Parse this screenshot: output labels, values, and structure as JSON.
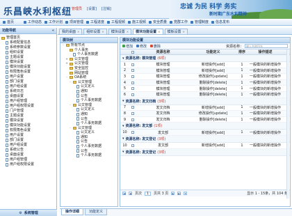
{
  "header": {
    "logo": "乐昌峡水利枢纽",
    "links": [
      "管理员",
      "[设置]",
      "[注销]"
    ],
    "slogan_main": "忠诚  为民  科学  务实",
    "slogan_sub": "新时期广东水利精神"
  },
  "menu": [
    "首页",
    "工作动态",
    "工作计划",
    "项目管理",
    "工程进度",
    "工程视频",
    "施工视频",
    "安全质量",
    "党群工作",
    "管理制度",
    "信息发布"
  ],
  "sidebar": {
    "title": "功能导航",
    "items": [
      "管理首页",
      "系统配置信息",
      "系统参数设置",
      "组织设置",
      "主题设置",
      "模块设置",
      "模块功能设置",
      "权限角色设置",
      "用户设置",
      "部门设置",
      "用户组设置",
      "系统日志",
      "桌面设置",
      "用户组管理",
      "用户组权限设置",
      "门户管理",
      "主题设置",
      "模块设置",
      "模块功能设置",
      "权限角色设置",
      "用户设置",
      "部门设置",
      "用户组设置",
      "系统公告",
      "桌面设置",
      "用户组管理",
      "用户组权限设置"
    ],
    "bottom_label": "系统管理"
  },
  "tabs": [
    "我的桌面",
    "组织设置",
    "模块设置",
    "模块功能设置",
    "模板设置"
  ],
  "tree": {
    "title": "模块树",
    "root": "所有节点",
    "nodes": [
      {
        "label": "个人事务",
        "depth": 1,
        "type": "folder",
        "toggle": ""
      },
      {
        "label": "个人事务数据",
        "depth": 2,
        "type": "page",
        "toggle": ""
      },
      {
        "label": "公文管理",
        "depth": 1,
        "type": "folder",
        "toggle": "+"
      },
      {
        "label": "公文管理",
        "depth": 1,
        "type": "folder",
        "toggle": "+"
      },
      {
        "label": "安全监控",
        "depth": 1,
        "type": "folder",
        "toggle": ""
      },
      {
        "label": "网站管理",
        "depth": 1,
        "type": "folder",
        "toggle": ""
      },
      {
        "label": "OA系统",
        "depth": 1,
        "type": "folder",
        "toggle": "-"
      },
      {
        "label": "公文管理",
        "depth": 2,
        "type": "folder",
        "toggle": "-"
      },
      {
        "label": "公文定义",
        "depth": 3,
        "type": "page",
        "toggle": ""
      },
      {
        "label": "通知",
        "depth": 3,
        "type": "page",
        "toggle": ""
      },
      {
        "label": "公告",
        "depth": 3,
        "type": "page",
        "toggle": ""
      },
      {
        "label": "个人事务数据",
        "depth": 3,
        "type": "page",
        "toggle": ""
      },
      {
        "label": "公文管理",
        "depth": 2,
        "type": "folder",
        "toggle": "-"
      },
      {
        "label": "公文定义",
        "depth": 3,
        "type": "page",
        "toggle": ""
      },
      {
        "label": "通知",
        "depth": 3,
        "type": "page",
        "toggle": ""
      },
      {
        "label": "公告",
        "depth": 3,
        "type": "page",
        "toggle": ""
      },
      {
        "label": "个人事务数据",
        "depth": 3,
        "type": "page",
        "toggle": ""
      },
      {
        "label": "公文管理",
        "depth": 2,
        "type": "folder",
        "toggle": "-"
      },
      {
        "label": "公文定义",
        "depth": 3,
        "type": "page",
        "toggle": ""
      },
      {
        "label": "通知",
        "depth": 3,
        "type": "page",
        "toggle": ""
      },
      {
        "label": "公告",
        "depth": 3,
        "type": "page",
        "toggle": ""
      },
      {
        "label": "个人事务数据",
        "depth": 3,
        "type": "page",
        "toggle": ""
      },
      {
        "label": "公告",
        "depth": 3,
        "type": "page",
        "toggle": ""
      },
      {
        "label": "个人事务数据",
        "depth": 3,
        "type": "page",
        "toggle": ""
      }
    ]
  },
  "bottom_tabs": [
    "操作详细",
    "功能定义"
  ],
  "grid": {
    "title": "模块功能设置",
    "toolbar": {
      "add": "增加",
      "edit": "修改",
      "delete": "删除"
    },
    "search_label": "资源名称：",
    "search_placeholder": "输入名称回车",
    "columns": [
      "资源名称",
      "功能定义",
      "排序",
      "操作描述"
    ],
    "groups": [
      {
        "label": "资源名称: 模块管理",
        "count": "(6项)",
        "rows": [
          {
            "num": "1",
            "name": "模块管理",
            "func": "新增操作[add]",
            "order": "1",
            "desc": "一般模块的新增操作"
          },
          {
            "num": "2",
            "name": "模块管理",
            "func": "新增操作[add]",
            "order": "1",
            "desc": "一般模块的新增操作"
          },
          {
            "num": "3",
            "name": "模块管理",
            "func": "修改操作[update]",
            "order": "1",
            "desc": "一般模块的新增操作"
          },
          {
            "num": "4",
            "name": "模块管理",
            "func": "删除操作[delete]",
            "order": "1",
            "desc": "一般模块的新增操作"
          },
          {
            "num": "5",
            "name": "模块管理",
            "func": "删除操作[delete]",
            "order": "1",
            "desc": "一般模块的新增操作"
          },
          {
            "num": "6",
            "name": "模块管理",
            "func": "删除操作[delete]",
            "order": "1",
            "desc": "一般模块的新增操作"
          }
        ]
      },
      {
        "label": "资源名称: 发文归档",
        "count": "(3项)",
        "rows": [
          {
            "num": "7",
            "name": "发文归档",
            "func": "新增操作[add]",
            "order": "1",
            "desc": "一般模块的新增操作"
          },
          {
            "num": "8",
            "name": "发文归档",
            "func": "修改操作[update]",
            "order": "1",
            "desc": "一般模块的新增操作"
          },
          {
            "num": "9",
            "name": "发文归档",
            "func": "删除操作[delete]",
            "order": "1",
            "desc": "一般模块的新增操作"
          }
        ]
      },
      {
        "label": "资源名称: 发文部",
        "count": "(1项)",
        "rows": [
          {
            "num": "10",
            "name": "发文部",
            "func": "新增操作[add]",
            "order": "1",
            "desc": "一般模块的新增操作"
          }
        ]
      },
      {
        "label": "资源名称: 发文登记",
        "count": "(3项)",
        "rows": [
          {
            "num": "10",
            "name": "发文部",
            "func": "新增操作[add]",
            "order": "1",
            "desc": "一般模块的新增操作"
          }
        ]
      },
      {
        "label": "资源名称: 发文登记",
        "count": "(3项)",
        "rows": []
      }
    ],
    "pager": {
      "page_label": "页次",
      "page_value": "1",
      "of_label": "页共 3 页",
      "info": "显示 1 - 15条，共 104 条"
    }
  },
  "colors": {
    "accent": "#1a4f8f",
    "border": "#9cc0e3",
    "header_bg": "#e9f2fb"
  }
}
